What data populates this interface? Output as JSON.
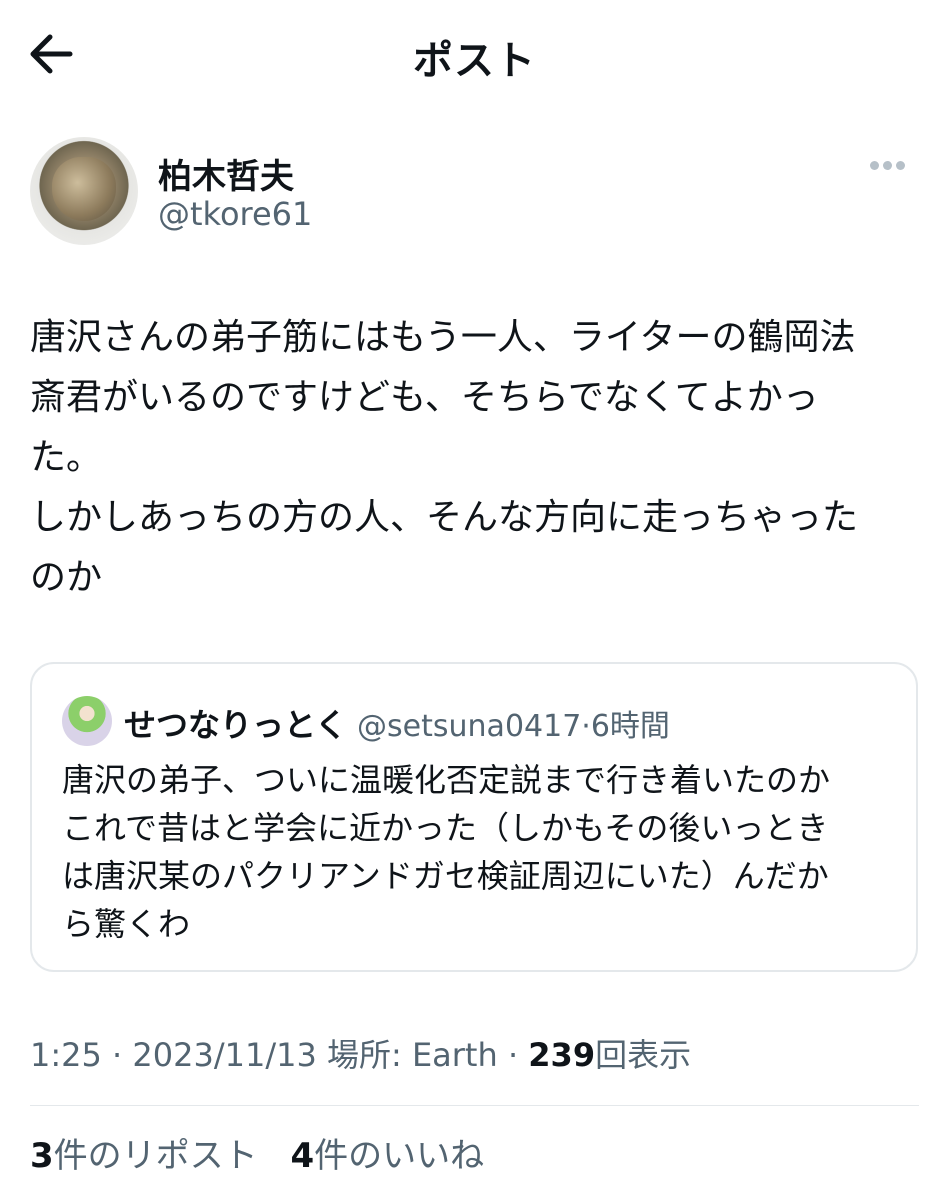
{
  "header": {
    "title": "ポスト",
    "back_icon": "arrow-left-icon"
  },
  "author": {
    "display_name": "柏木哲夫",
    "handle": "@tkore61"
  },
  "post": {
    "text": "唐沢さんの弟子筋にはもう一人、ライターの鶴岡法\n斎君がいるのですけども、そちらでなくてよかっ\nた。\nしかしあっちの方の人、そんな方向に走っちゃった\nのか"
  },
  "quote": {
    "display_name": "せつなりっとく",
    "handle": "@setsuna0417",
    "separator": "·",
    "time": "6時間",
    "text": "唐沢の弟子、ついに温暖化否定説まで行き着いたのか\nこれで昔はと学会に近かった（しかもその後いっとき\nは唐沢某のパクリアンドガセ検証周辺にいた）んだか\nら驚くわ"
  },
  "meta": {
    "time": "1:25",
    "sep1": "·",
    "date": "2023/11/13",
    "location_label": "場所: Earth",
    "sep2": "·",
    "views": "239",
    "views_label": "回表示"
  },
  "stats": {
    "reposts": "3",
    "reposts_label": "件のリポスト",
    "likes": "4",
    "likes_label": "件のいいね"
  },
  "colors": {
    "text": "#0f1419",
    "secondary": "#536471",
    "border": "#e4e8eb"
  }
}
